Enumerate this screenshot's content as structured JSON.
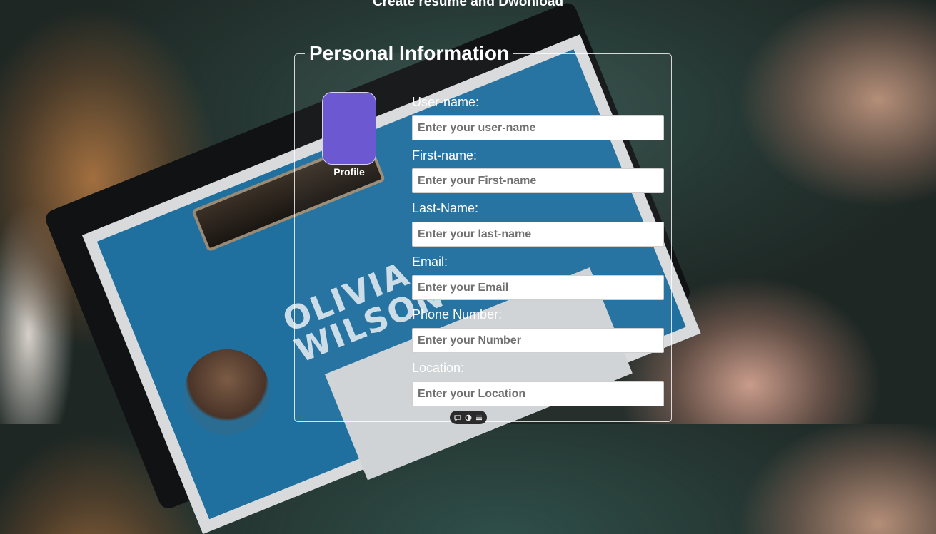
{
  "page": {
    "top_heading": "Create resume and Dwonload"
  },
  "section": {
    "legend": "Personal Information"
  },
  "profile": {
    "label": "Profile",
    "color": "#6c59d1"
  },
  "background_art": {
    "name_line1": "OLIVIA",
    "name_line2": "WILSON"
  },
  "fields": [
    {
      "label": "User-name:",
      "placeholder": "Enter your user-name",
      "value": ""
    },
    {
      "label": "First-name:",
      "placeholder": "Enter your First-name",
      "value": ""
    },
    {
      "label": "Last-Name:",
      "placeholder": "Enter your last-name",
      "value": ""
    },
    {
      "label": "Email:",
      "placeholder": "Enter your Email",
      "value": ""
    },
    {
      "label": "Phone Number:",
      "placeholder": "Enter your Number",
      "value": ""
    },
    {
      "label": "Location:",
      "placeholder": "Enter your Location",
      "value": ""
    }
  ],
  "toolbar": {
    "icons": [
      "comment-icon",
      "contrast-icon",
      "list-icon"
    ]
  }
}
